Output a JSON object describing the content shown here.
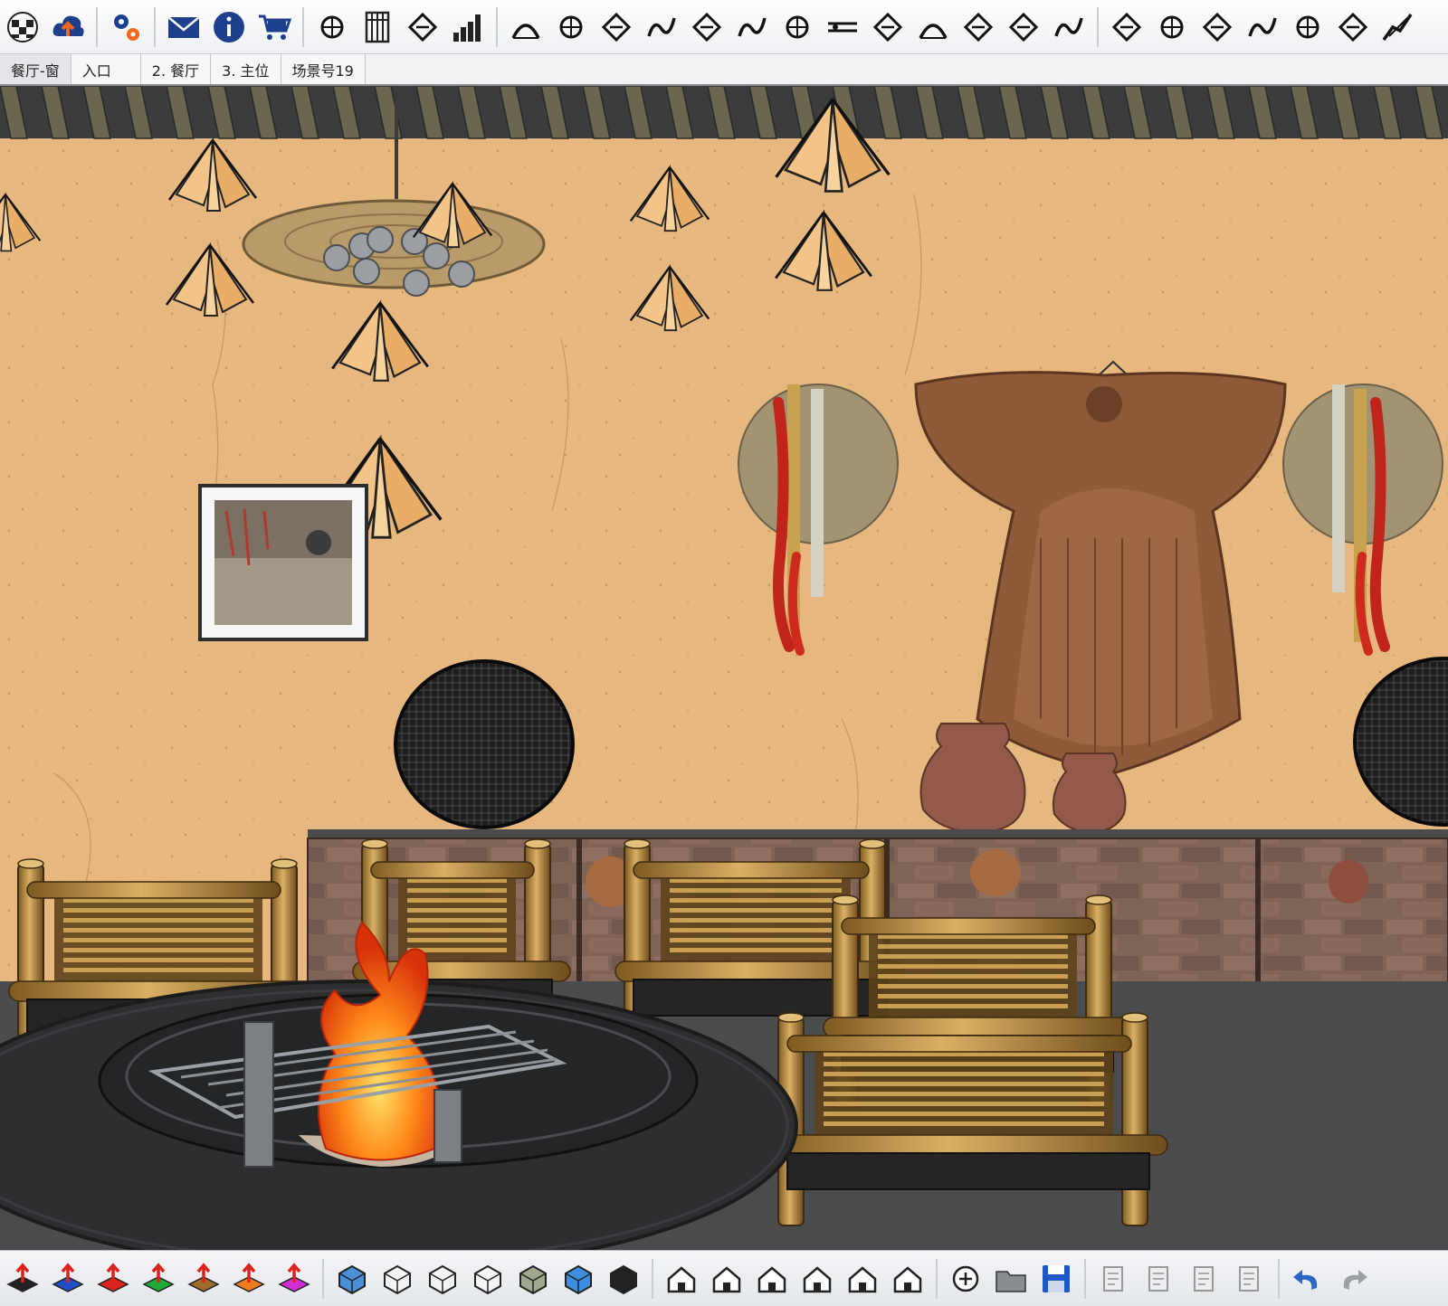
{
  "colors": {
    "wall": "#e6b77f",
    "roof_beam": "#3a3c3d",
    "bamboo": "#c59a4a",
    "fire": "#f16a10",
    "table": "#2d2e30",
    "counter": "#7a5e52",
    "toolbar_blue": "#1e3f8c"
  },
  "top_toolbar": {
    "tools": [
      "globe-checker-icon",
      "cloud-upload-icon",
      "gear-cluster-icon",
      "mail-icon",
      "info-icon",
      "cart-icon",
      "stair-icon",
      "window-frame-icon",
      "ramp-icon",
      "bar-chart-icon",
      "robot-arm-icon",
      "align-lines-icon",
      "bend-arrow-icon",
      "branch-icon",
      "arch-icon",
      "rotate-icon",
      "joint-icon",
      "box-tray-icon",
      "pen-circle-icon",
      "tile-grid-icon",
      "tile-arrow-icon",
      "door-panel-icon",
      "layers-icon",
      "curve-arch-icon",
      "chain-icon",
      "wave-icon",
      "spiral-icon",
      "wedge-icon",
      "comb-icon",
      "railing-icon"
    ]
  },
  "scene_tabs": [
    {
      "label": "餐厅-窗"
    },
    {
      "label": "入口"
    },
    {
      "label": "2. 餐厅"
    },
    {
      "label": "3. 主位"
    },
    {
      "label": "场景号19"
    }
  ],
  "bottom_toolbar": {
    "tools": [
      "push-down-black-icon",
      "push-up-blue-icon",
      "push-up-red-icon",
      "push-up-green-icon",
      "push-up-brown-icon",
      "push-up-orange-icon",
      "push-up-magenta-icon",
      "view-box-blue-icon",
      "view-box-wire-icon",
      "view-wireframe-icon",
      "view-hidden-line-icon",
      "view-shaded-icon",
      "view-textured-icon",
      "view-mono-icon",
      "view-iso-house-icon",
      "view-top-icon",
      "view-front-icon",
      "view-right-icon",
      "view-back-icon",
      "view-left-icon",
      "zoom-plus-icon",
      "open-folder-icon",
      "save-icon",
      "cut-icon",
      "copy-icon",
      "paste-icon",
      "erase-icon",
      "undo-icon",
      "redo-icon"
    ]
  }
}
